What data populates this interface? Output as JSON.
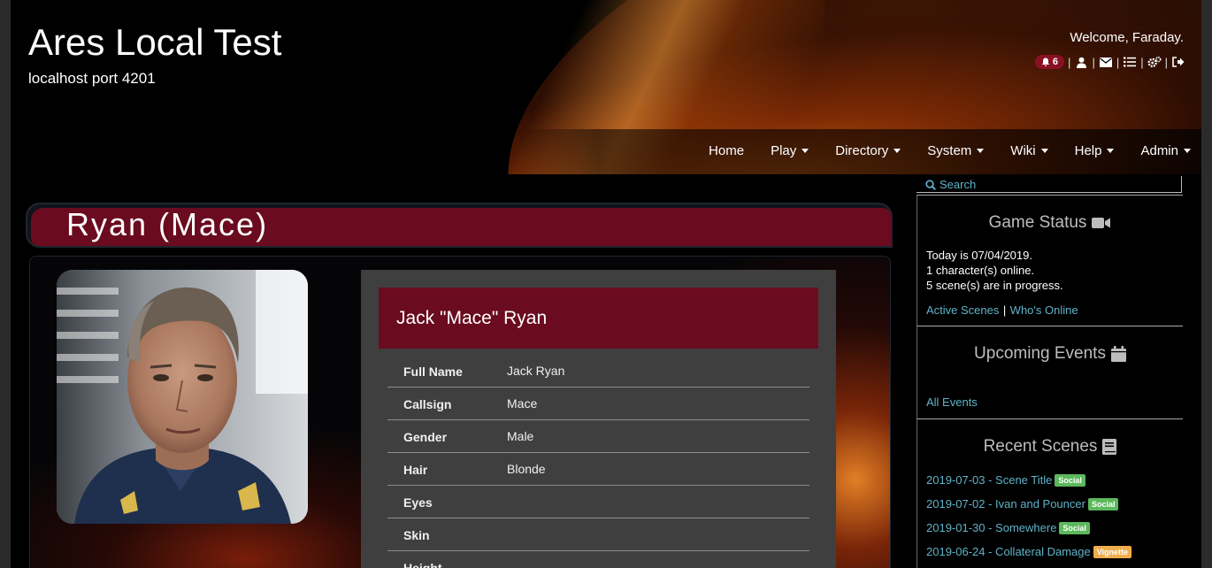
{
  "site": {
    "title": "Ares Local Test",
    "subtitle": "localhost port 4201"
  },
  "user": {
    "welcome": "Welcome, Faraday.",
    "notification_count": "6",
    "icons": [
      "bell-icon",
      "user-icon",
      "mail-icon",
      "list-icon",
      "gears-icon",
      "sign-out-icon"
    ]
  },
  "nav": {
    "items": [
      {
        "label": "Home",
        "dropdown": false
      },
      {
        "label": "Play",
        "dropdown": true
      },
      {
        "label": "Directory",
        "dropdown": true
      },
      {
        "label": "System",
        "dropdown": true
      },
      {
        "label": "Wiki",
        "dropdown": true
      },
      {
        "label": "Help",
        "dropdown": true
      },
      {
        "label": "Admin",
        "dropdown": true
      }
    ]
  },
  "character": {
    "banner_title": "Ryan (Mace)",
    "display_name": "Jack \"Mace\" Ryan",
    "fields": [
      {
        "label": "Full Name",
        "value": "Jack Ryan"
      },
      {
        "label": "Callsign",
        "value": "Mace"
      },
      {
        "label": "Gender",
        "value": "Male"
      },
      {
        "label": "Hair",
        "value": "Blonde"
      },
      {
        "label": "Eyes",
        "value": ""
      },
      {
        "label": "Skin",
        "value": ""
      },
      {
        "label": "Height",
        "value": ""
      }
    ]
  },
  "sidebar": {
    "search_label": "Search",
    "game_status": {
      "title": "Game Status",
      "today": "Today is 07/04/2019.",
      "online": "1 character(s) online.",
      "scenes": "5 scene(s) are in progress.",
      "link_active": "Active Scenes",
      "link_separator": "|",
      "link_online": "Who's Online"
    },
    "events": {
      "title": "Upcoming Events",
      "link_all": "All Events"
    },
    "recent_scenes": {
      "title": "Recent Scenes",
      "items": [
        {
          "label": "2019-07-03 - Scene Title",
          "badge": "Social",
          "badge_color": "#5cb85c"
        },
        {
          "label": "2019-07-02 - Ivan and Pouncer",
          "badge": "Social",
          "badge_color": "#5cb85c"
        },
        {
          "label": "2019-01-30 - Somewhere",
          "badge": "Social",
          "badge_color": "#5cb85c"
        },
        {
          "label": "2019-06-24 - Collateral Damage",
          "badge": "Vignette",
          "badge_color": "#f0ad4e"
        }
      ]
    }
  },
  "colors": {
    "accent_maroon": "#6a0b1f",
    "link": "#5fb3c9",
    "panel": "#3f3f3f"
  }
}
